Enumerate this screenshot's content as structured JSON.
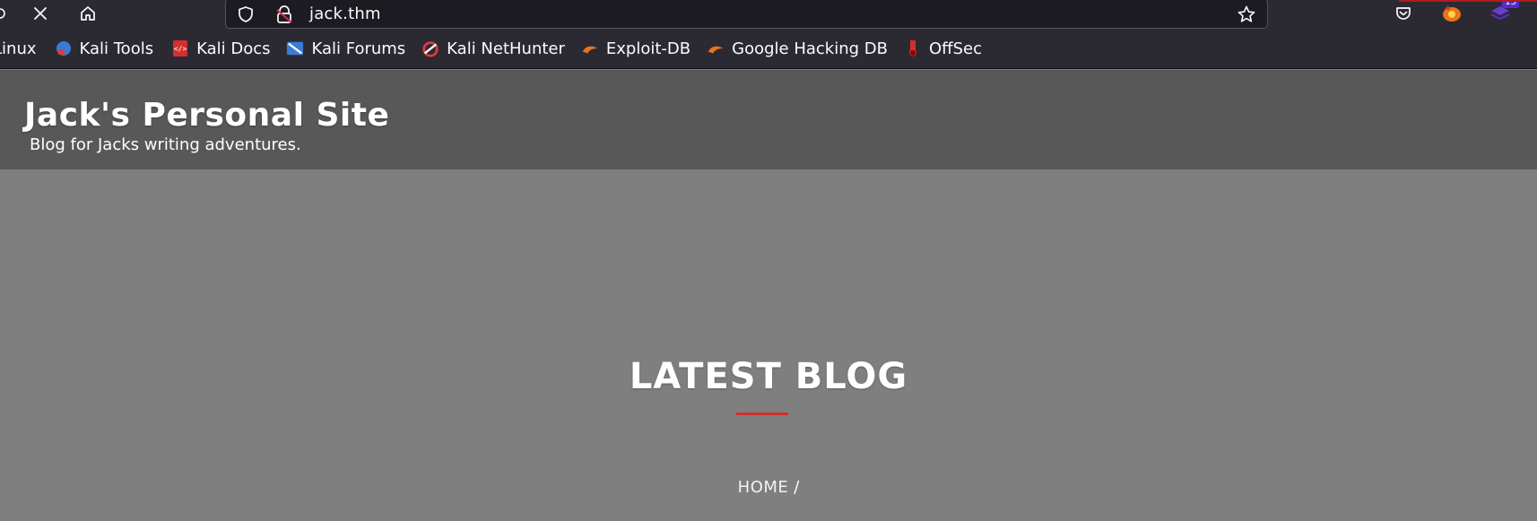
{
  "browser": {
    "url": "jack.thm",
    "extension_badge_count": "15",
    "accent_red": "#b31b1b",
    "icons": [
      "partial-left-icon",
      "close-icon",
      "home-icon",
      "shield-icon",
      "insecure-lock-icon",
      "star-icon",
      "pocket-icon",
      "firefox-extension-icon",
      "extension-stack-icon"
    ]
  },
  "bookmarks": [
    {
      "label": "Linux",
      "icon": "none"
    },
    {
      "label": "Kali Tools",
      "icon": "kali-tools-icon"
    },
    {
      "label": "Kali Docs",
      "icon": "kali-docs-icon"
    },
    {
      "label": "Kali Forums",
      "icon": "kali-forums-icon"
    },
    {
      "label": "Kali NetHunter",
      "icon": "kali-nethunter-icon"
    },
    {
      "label": "Exploit-DB",
      "icon": "exploit-db-icon"
    },
    {
      "label": "Google Hacking DB",
      "icon": "google-hacking-db-icon"
    },
    {
      "label": "OffSec",
      "icon": "offsec-icon"
    }
  ],
  "site": {
    "title": "Jack's Personal Site",
    "tagline": "Blog for Jacks writing adventures."
  },
  "hero": {
    "title": "LATEST BLOG",
    "underline_color": "#d32f2f",
    "breadcrumb_home": "HOME",
    "breadcrumb_sep": "/"
  }
}
